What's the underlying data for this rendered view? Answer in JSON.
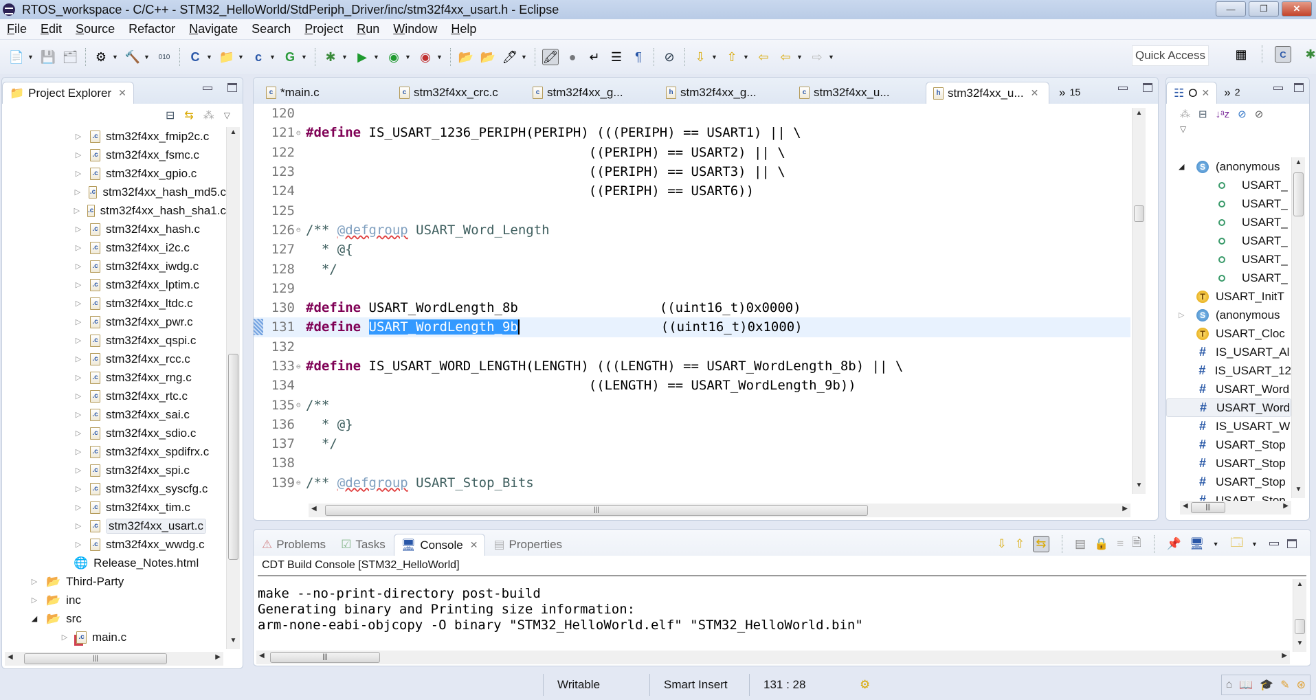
{
  "window": {
    "title": "RTOS_workspace - C/C++ - STM32_HelloWorld/StdPeriph_Driver/inc/stm32f4xx_usart.h - Eclipse",
    "buttons": {
      "minimize": "—",
      "restore": "❐",
      "close": "✕"
    }
  },
  "menu": [
    {
      "label": "File",
      "mn": "F",
      "rest": "ile"
    },
    {
      "label": "Edit",
      "mn": "E",
      "rest": "dit"
    },
    {
      "label": "Source",
      "mn": "S",
      "rest": "ource"
    },
    {
      "label": "Refactor",
      "mn": "",
      "rest": "Refactor"
    },
    {
      "label": "Navigate",
      "mn": "N",
      "rest": "avigate"
    },
    {
      "label": "Search",
      "mn": "",
      "rest": "Search"
    },
    {
      "label": "Project",
      "mn": "P",
      "rest": "roject"
    },
    {
      "label": "Run",
      "mn": "R",
      "rest": "un"
    },
    {
      "label": "Window",
      "mn": "W",
      "rest": "indow"
    },
    {
      "label": "Help",
      "mn": "H",
      "rest": "elp"
    }
  ],
  "toolbar": {
    "quick_access": "Quick Access",
    "icons": [
      "new-icon",
      "save-icon",
      "save-all-icon",
      "build-config-icon",
      "build-icon",
      "binary-icon",
      "new-c-project-icon",
      "new-source-folder-icon",
      "new-c-file-icon",
      "new-class-icon",
      "debug-icon",
      "run-icon",
      "run-config-icon",
      "external-tools-icon",
      "open-type-icon",
      "open-element-icon",
      "search-icon",
      "highlight-icon",
      "breakpoints-icon",
      "toggle-comment-icon",
      "show-whitespace-icon",
      "pilcrow-icon",
      "skip-breakpoints-icon",
      "next-annotation-icon",
      "previous-annotation-icon",
      "last-edit-icon",
      "back-icon",
      "forward-icon"
    ]
  },
  "project_explorer": {
    "title": "Project Explorer",
    "items": [
      {
        "label": "stm32f4xx_fmip2c.c",
        "type": "c",
        "level": 3
      },
      {
        "label": "stm32f4xx_fsmc.c",
        "type": "c",
        "level": 3
      },
      {
        "label": "stm32f4xx_gpio.c",
        "type": "c",
        "level": 3
      },
      {
        "label": "stm32f4xx_hash_md5.c",
        "type": "c",
        "level": 3
      },
      {
        "label": "stm32f4xx_hash_sha1.c",
        "type": "c",
        "level": 3
      },
      {
        "label": "stm32f4xx_hash.c",
        "type": "c",
        "level": 3
      },
      {
        "label": "stm32f4xx_i2c.c",
        "type": "c",
        "level": 3
      },
      {
        "label": "stm32f4xx_iwdg.c",
        "type": "c",
        "level": 3
      },
      {
        "label": "stm32f4xx_lptim.c",
        "type": "c",
        "level": 3
      },
      {
        "label": "stm32f4xx_ltdc.c",
        "type": "c",
        "level": 3
      },
      {
        "label": "stm32f4xx_pwr.c",
        "type": "c",
        "level": 3
      },
      {
        "label": "stm32f4xx_qspi.c",
        "type": "c",
        "level": 3
      },
      {
        "label": "stm32f4xx_rcc.c",
        "type": "c",
        "level": 3
      },
      {
        "label": "stm32f4xx_rng.c",
        "type": "c",
        "level": 3
      },
      {
        "label": "stm32f4xx_rtc.c",
        "type": "c",
        "level": 3
      },
      {
        "label": "stm32f4xx_sai.c",
        "type": "c",
        "level": 3
      },
      {
        "label": "stm32f4xx_sdio.c",
        "type": "c",
        "level": 3
      },
      {
        "label": "stm32f4xx_spdifrx.c",
        "type": "c",
        "level": 3
      },
      {
        "label": "stm32f4xx_spi.c",
        "type": "c",
        "level": 3
      },
      {
        "label": "stm32f4xx_syscfg.c",
        "type": "c",
        "level": 3
      },
      {
        "label": "stm32f4xx_tim.c",
        "type": "c",
        "level": 3
      },
      {
        "label": "stm32f4xx_usart.c",
        "type": "c",
        "level": 3,
        "selected": true
      },
      {
        "label": "stm32f4xx_wwdg.c",
        "type": "c",
        "level": 3
      },
      {
        "label": "Release_Notes.html",
        "type": "html",
        "level": 2
      },
      {
        "label": "Third-Party",
        "type": "folder",
        "level": 1
      },
      {
        "label": "inc",
        "type": "folder",
        "level": 1
      },
      {
        "label": "src",
        "type": "folder-error",
        "level": 1,
        "expanded": true
      },
      {
        "label": "main.c",
        "type": "c-error",
        "level": 2
      }
    ]
  },
  "editor": {
    "tabs": [
      {
        "label": "*main.c",
        "type": "c"
      },
      {
        "label": "stm32f4xx_crc.c",
        "type": "c"
      },
      {
        "label": "stm32f4xx_g...",
        "type": "c"
      },
      {
        "label": "stm32f4xx_g...",
        "type": "h"
      },
      {
        "label": "stm32f4xx_u...",
        "type": "c"
      },
      {
        "label": "stm32f4xx_u...",
        "type": "h",
        "active": true
      }
    ],
    "overflow_count": "15",
    "current_line": 131,
    "lines": [
      {
        "n": "120",
        "fold": false,
        "segs": []
      },
      {
        "n": "121",
        "fold": true,
        "segs": [
          {
            "t": "kw",
            "v": "#define"
          },
          {
            "t": "",
            "v": " IS_USART_1236_PERIPH(PERIPH) (((PERIPH) == USART1) || \\"
          }
        ]
      },
      {
        "n": "122",
        "fold": false,
        "segs": [
          {
            "t": "",
            "v": "                                    ((PERIPH) == USART2) || \\"
          }
        ]
      },
      {
        "n": "123",
        "fold": false,
        "segs": [
          {
            "t": "",
            "v": "                                    ((PERIPH) == USART3) || \\"
          }
        ]
      },
      {
        "n": "124",
        "fold": false,
        "segs": [
          {
            "t": "",
            "v": "                                    ((PERIPH) == USART6))"
          }
        ]
      },
      {
        "n": "125",
        "fold": false,
        "segs": []
      },
      {
        "n": "126",
        "fold": true,
        "segs": [
          {
            "t": "cm",
            "v": "/** "
          },
          {
            "t": "dt",
            "v": "@defgroup"
          },
          {
            "t": "cm",
            "v": " USART_Word_Length"
          }
        ]
      },
      {
        "n": "127",
        "fold": false,
        "segs": [
          {
            "t": "cm",
            "v": "  * @{"
          }
        ]
      },
      {
        "n": "128",
        "fold": false,
        "segs": [
          {
            "t": "cm",
            "v": "  */"
          }
        ]
      },
      {
        "n": "129",
        "fold": false,
        "segs": []
      },
      {
        "n": "130",
        "fold": false,
        "segs": [
          {
            "t": "kw",
            "v": "#define"
          },
          {
            "t": "",
            "v": " USART_WordLength_8b                  ((uint16_t)0x0000)"
          }
        ]
      },
      {
        "n": "131",
        "fold": false,
        "segs": [
          {
            "t": "kw",
            "v": "#define"
          },
          {
            "t": "",
            "v": " "
          },
          {
            "t": "selword",
            "v": "USART_WordLength_9b"
          },
          {
            "t": "",
            "v": "                  ((uint16_t)0x1000)"
          }
        ]
      },
      {
        "n": "132",
        "fold": false,
        "segs": []
      },
      {
        "n": "133",
        "fold": true,
        "segs": [
          {
            "t": "kw",
            "v": "#define"
          },
          {
            "t": "",
            "v": " IS_USART_WORD_LENGTH(LENGTH) (((LENGTH) == USART_WordLength_8b) || \\"
          }
        ]
      },
      {
        "n": "134",
        "fold": false,
        "segs": [
          {
            "t": "",
            "v": "                                    ((LENGTH) == USART_WordLength_9b))"
          }
        ]
      },
      {
        "n": "135",
        "fold": true,
        "segs": [
          {
            "t": "cm",
            "v": "/**"
          }
        ]
      },
      {
        "n": "136",
        "fold": false,
        "segs": [
          {
            "t": "cm",
            "v": "  * @}"
          }
        ]
      },
      {
        "n": "137",
        "fold": false,
        "segs": [
          {
            "t": "cm",
            "v": "  */"
          }
        ]
      },
      {
        "n": "138",
        "fold": false,
        "segs": []
      },
      {
        "n": "139",
        "fold": true,
        "segs": [
          {
            "t": "cm",
            "v": "/** "
          },
          {
            "t": "dt",
            "v": "@defgroup"
          },
          {
            "t": "cm",
            "v": " USART_Stop_Bits"
          }
        ]
      }
    ]
  },
  "outline": {
    "tab_label": "O",
    "overflow_count": "2",
    "items": [
      {
        "icon": "s",
        "label": "(anonymous",
        "twisty": "open"
      },
      {
        "icon": "f",
        "label": "USART_",
        "indent": true
      },
      {
        "icon": "f",
        "label": "USART_",
        "indent": true
      },
      {
        "icon": "f",
        "label": "USART_",
        "indent": true
      },
      {
        "icon": "f",
        "label": "USART_",
        "indent": true
      },
      {
        "icon": "f",
        "label": "USART_",
        "indent": true
      },
      {
        "icon": "f",
        "label": "USART_",
        "indent": true
      },
      {
        "icon": "t",
        "label": "USART_InitT"
      },
      {
        "icon": "s",
        "label": "(anonymous",
        "twisty": "closed"
      },
      {
        "icon": "t",
        "label": "USART_Cloc"
      },
      {
        "icon": "h",
        "label": "IS_USART_Al"
      },
      {
        "icon": "h",
        "label": "IS_USART_12"
      },
      {
        "icon": "h",
        "label": "USART_Word"
      },
      {
        "icon": "h",
        "label": "USART_Word",
        "selected": true
      },
      {
        "icon": "h",
        "label": "IS_USART_W"
      },
      {
        "icon": "h",
        "label": "USART_Stop"
      },
      {
        "icon": "h",
        "label": "USART_Stop"
      },
      {
        "icon": "h",
        "label": "USART_Stop"
      },
      {
        "icon": "h",
        "label": "USART_Stop"
      }
    ]
  },
  "bottom_panel": {
    "tabs": [
      {
        "label": "Problems",
        "active": false
      },
      {
        "label": "Tasks",
        "active": false
      },
      {
        "label": "Console",
        "active": true
      },
      {
        "label": "Properties",
        "active": false
      }
    ],
    "console_title": "CDT Build Console [STM32_HelloWorld]",
    "console_lines": [
      "make --no-print-directory post-build",
      "Generating binary and Printing size information:",
      "arm-none-eabi-objcopy -O binary \"STM32_HelloWorld.elf\" \"STM32_HelloWorld.bin\""
    ]
  },
  "status": {
    "writable": "Writable",
    "insert_mode": "Smart Insert",
    "position": "131 : 28"
  }
}
